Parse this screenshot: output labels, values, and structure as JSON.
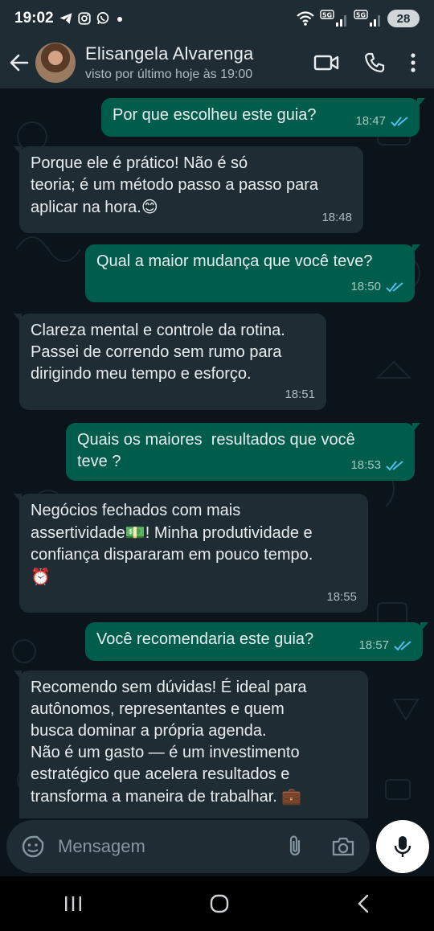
{
  "status_bar": {
    "time": "19:02",
    "battery": "28",
    "icons_left": [
      "telegram-icon",
      "instagram-icon",
      "whatsapp-icon",
      "dot-icon"
    ],
    "icons_right": [
      "wifi-icon",
      "signal-5g-icon",
      "signal-5g-icon-2"
    ]
  },
  "header": {
    "name": "Elisangela Alvarenga",
    "status": "visto por último hoje às 19:00"
  },
  "messages": [
    {
      "dir": "out",
      "text": "Por que escolheu este guia?",
      "time": "18:47"
    },
    {
      "dir": "in",
      "text": "Porque ele é prático! Não é só\nteoria; é um método passo a passo para\naplicar na hora.",
      "emoji": "😊",
      "time": "18:48"
    },
    {
      "dir": "out",
      "text": "Qual a maior mudança que você teve?",
      "time": "18:50"
    },
    {
      "dir": "in",
      "text": "Clareza mental e controle da rotina.\nPassei de correndo sem rumo para\ndirigindo meu tempo e esforço.",
      "time": "18:51"
    },
    {
      "dir": "out",
      "text": "Quais os maiores  resultados que você\nteve ?",
      "time": "18:53"
    },
    {
      "dir": "in",
      "text_a": "Negócios fechados com mais\nassertividade",
      "emoji_a": "💵",
      "text_b": "! Minha produtividade e\nconfiança dispararam em pouco tempo.",
      "emoji_b": "⏰",
      "time": "18:55"
    },
    {
      "dir": "out",
      "text": "Você recomendaria este guia?",
      "time": "18:57"
    },
    {
      "dir": "in",
      "text": "Recomendo sem dúvidas! É ideal para\nautônomos, representantes e quem\nbusca dominar a própria agenda.\nNão é um gasto — é um investimento\nestratégico que acelera resultados e\ntransforma a maneira de trabalhar.",
      "emoji": "💼"
    }
  ],
  "composer": {
    "placeholder": "Mensagem"
  },
  "colors": {
    "outgoing": "#005c4b",
    "incoming": "#202c33",
    "background": "#0b141a",
    "read_ticks": "#53bdeb"
  }
}
